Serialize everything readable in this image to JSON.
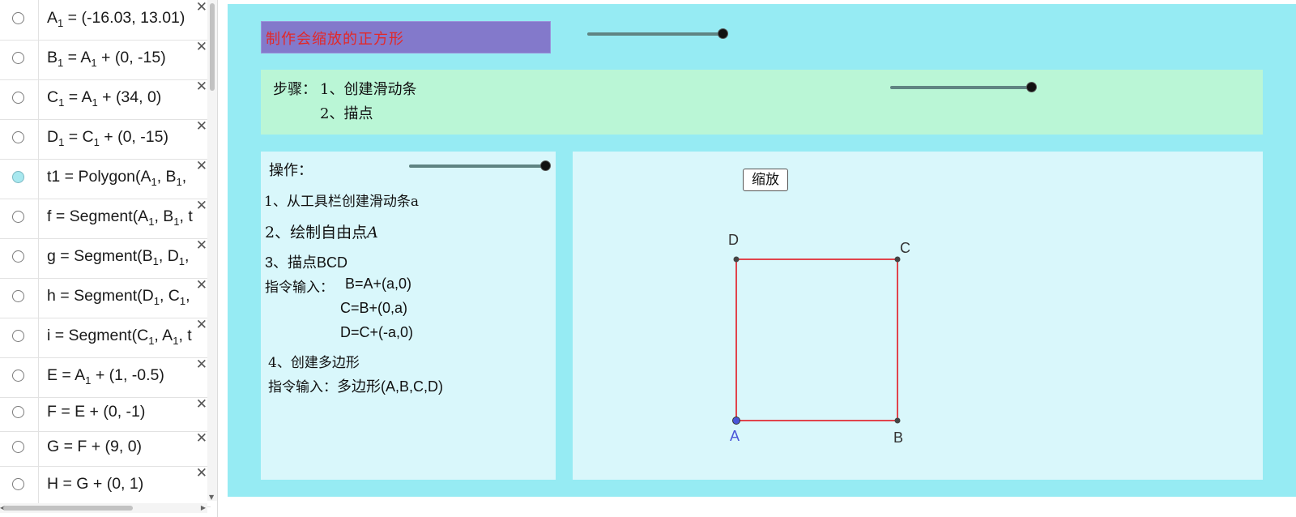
{
  "algebra": {
    "rows": [
      {
        "id": "a1",
        "prefix": "A",
        "sub": "1",
        "rest": " = (-16.03, 13.01)"
      },
      {
        "id": "b1",
        "prefix": "B",
        "sub": "1",
        "rest": " = A",
        "sub2": "1",
        "rest2": " + (0, -15)"
      },
      {
        "id": "c1",
        "prefix": "C",
        "sub": "1",
        "rest": " = A",
        "sub2": "1",
        "rest2": " + (34, 0)"
      },
      {
        "id": "d1",
        "prefix": "D",
        "sub": "1",
        "rest": " = C",
        "sub2": "1",
        "rest2": " + (0, -15)"
      },
      {
        "id": "t1",
        "prefix": "t1 = Polygon(A",
        "sub": "1",
        "rest": ", B",
        "sub2": "1",
        "rest2": ","
      },
      {
        "id": "f",
        "prefix": "f = Segment(A",
        "sub": "1",
        "rest": ", B",
        "sub2": "1",
        "rest2": ", t"
      },
      {
        "id": "g",
        "prefix": "g = Segment(B",
        "sub": "1",
        "rest": ", D",
        "sub2": "1",
        "rest2": ","
      },
      {
        "id": "h",
        "prefix": "h = Segment(D",
        "sub": "1",
        "rest": ", C",
        "sub2": "1",
        "rest2": ","
      },
      {
        "id": "i",
        "prefix": "i = Segment(C",
        "sub": "1",
        "rest": ", A",
        "sub2": "1",
        "rest2": ", t"
      },
      {
        "id": "e",
        "prefix": "E = A",
        "sub": "1",
        "rest": " + (1, -0.5)"
      },
      {
        "id": "ff",
        "prefix": "F = E + (0, -1)"
      },
      {
        "id": "gg",
        "prefix": "G = F + (9, 0)"
      },
      {
        "id": "hh",
        "prefix": "H = G + (0, 1)"
      }
    ],
    "close_glyph": "✕"
  },
  "graphics": {
    "title": "制作会缩放的正方形",
    "steps": {
      "label": "步骤：",
      "step1": "1、创建滑动条",
      "step2": "2、描点"
    },
    "ops": {
      "label": "操作：",
      "line1": "1、从工具栏创建滑动条a",
      "line2_prefix": "2、绘制自由点",
      "line2_var": "A",
      "line3": "3、描点BCD",
      "cmd_label": "指令输入：",
      "cmd1": "B=A+(a,0)",
      "cmd2": "C=B+(0,a)",
      "cmd3": "D=C+(-a,0)",
      "line4": "4、创建多边形",
      "cmd4_label": "指令输入：",
      "cmd4": "多边形(A,B,C,D)"
    },
    "zoom_button": "缩放",
    "points": {
      "A": "A",
      "B": "B",
      "C": "C",
      "D": "D"
    },
    "colors": {
      "background": "#96ebf3",
      "title_bg": "#8379cb",
      "title_text": "#e32828",
      "steps_bg": "#baf6d6",
      "panel_bg": "#d9f7fb",
      "square_stroke": "#e0444c",
      "point_A": "#4a55d8",
      "slider": "#5f8482"
    },
    "sliders": [
      {
        "name": "slider-top",
        "value": 1.0
      },
      {
        "name": "slider-steps",
        "value": 1.0
      },
      {
        "name": "slider-ops",
        "value": 1.0
      }
    ]
  }
}
